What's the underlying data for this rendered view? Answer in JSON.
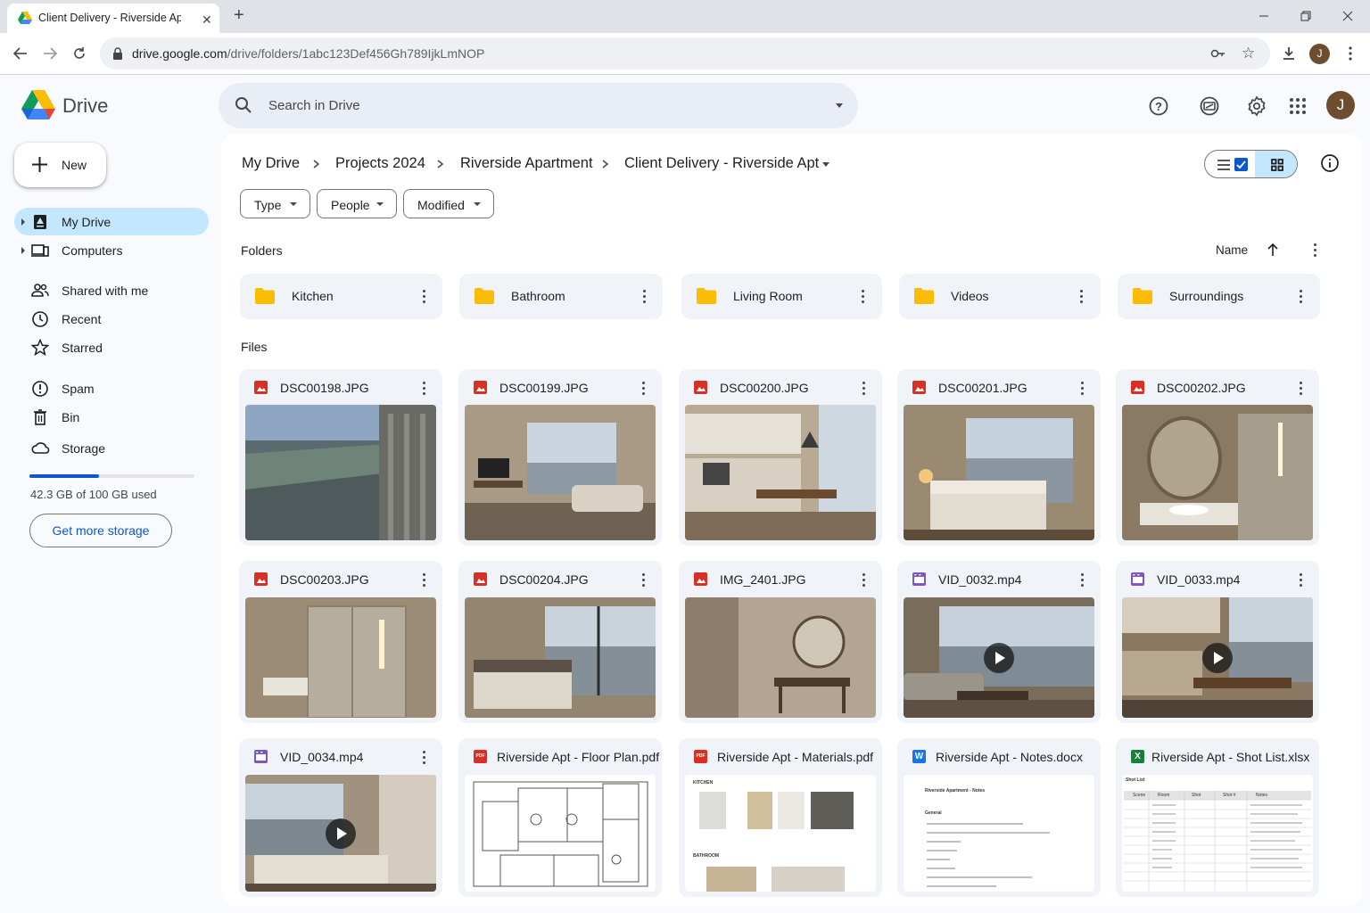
{
  "browser": {
    "tab_title": "Client Delivery - Riverside Apt - Google Drive",
    "url_domain": "drive.google.com",
    "url_path": "/drive/folders/1abc123Def456Gh789IjkLmNOP",
    "profile_initial": "J"
  },
  "app": {
    "name": "Drive",
    "search_placeholder": "Search in Drive",
    "avatar_initial": "J"
  },
  "sidebar": {
    "new_label": "New",
    "items": [
      {
        "label": "My Drive",
        "icon": "my-drive-icon",
        "active": true
      },
      {
        "label": "Computers",
        "icon": "computers-icon"
      },
      {
        "label": "Shared with me",
        "icon": "shared-icon"
      },
      {
        "label": "Recent",
        "icon": "clock-icon"
      },
      {
        "label": "Starred",
        "icon": "star-icon"
      },
      {
        "label": "Spam",
        "icon": "spam-icon"
      },
      {
        "label": "Bin",
        "icon": "bin-icon"
      },
      {
        "label": "Storage",
        "icon": "cloud-icon"
      }
    ],
    "storage_used_fraction": 0.423,
    "storage_text": "42.3 GB of 100 GB used",
    "get_storage_label": "Get more storage"
  },
  "breadcrumb": [
    "My Drive",
    "Projects 2024",
    "Riverside Apartment",
    "Client Delivery - Riverside Apt"
  ],
  "filters": [
    "Type",
    "People",
    "Modified"
  ],
  "folders_heading": "Folders",
  "sort_label": "Name",
  "folders": [
    "Kitchen",
    "Bathroom",
    "Living Room",
    "Videos",
    "Surroundings"
  ],
  "files_heading": "Files",
  "files": [
    {
      "name": "DSC00198.JPG",
      "kind": "image"
    },
    {
      "name": "DSC00199.JPG",
      "kind": "image"
    },
    {
      "name": "DSC00200.JPG",
      "kind": "image"
    },
    {
      "name": "DSC00201.JPG",
      "kind": "image"
    },
    {
      "name": "DSC00202.JPG",
      "kind": "image"
    },
    {
      "name": "DSC00203.JPG",
      "kind": "image"
    },
    {
      "name": "DSC00204.JPG",
      "kind": "image"
    },
    {
      "name": "IMG_2401.JPG",
      "kind": "image"
    },
    {
      "name": "VID_0032.mp4",
      "kind": "video"
    },
    {
      "name": "VID_0033.mp4",
      "kind": "video"
    },
    {
      "name": "VID_0034.mp4",
      "kind": "video"
    },
    {
      "name": "Riverside Apt - Floor Plan.pdf",
      "kind": "pdf"
    },
    {
      "name": "Riverside Apt - Materials.pdf",
      "kind": "pdf"
    },
    {
      "name": "Riverside Apt - Notes.docx",
      "kind": "docx"
    },
    {
      "name": "Riverside Apt - Shot List.xlsx",
      "kind": "xlsx"
    }
  ],
  "doc_previews": {
    "materials": {
      "kitchen": "KITCHEN",
      "bathroom": "BATHROOM"
    },
    "notes": {
      "title": "Riverside Apartment - Notes",
      "section": "General"
    },
    "shotlist": {
      "title": "Shot List",
      "headers": [
        "Scene",
        "Room",
        "Shot",
        "Shot #",
        "Notes"
      ]
    }
  },
  "colors": {
    "accent": "#0b57d0",
    "active_nav": "#c2e7ff",
    "folder": "#fbbc04",
    "image_icon": "#d93025",
    "video_icon": "#7e57c2",
    "doc_icon": "#1a73e8",
    "sheet_icon": "#188038"
  }
}
